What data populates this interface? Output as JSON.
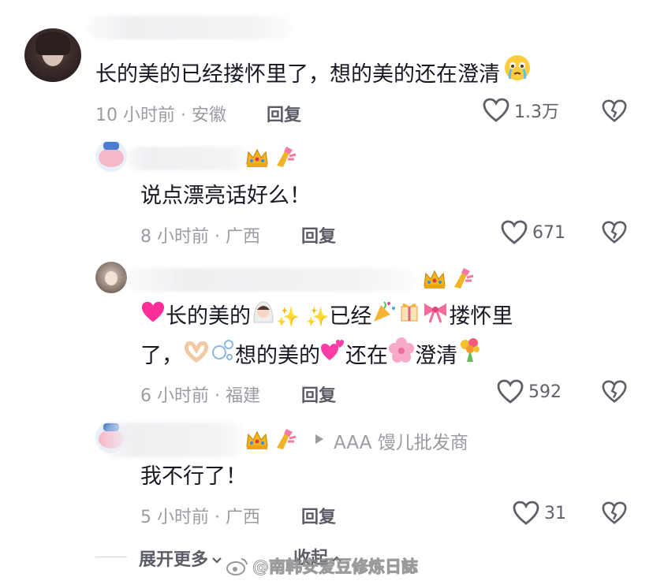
{
  "comments": [
    {
      "text": "长的美的已经搂怀里了，想的美的还在澄清",
      "meta": "10 小时前 · 安徽",
      "reply_label": "回复",
      "likes": "1.3万"
    },
    {
      "text": "说点漂亮话好么！",
      "meta": "8 小时前 · 广西",
      "reply_label": "回复",
      "likes": "671"
    },
    {
      "line1": [
        "长的美的",
        "已经",
        "搂怀里"
      ],
      "line2": [
        "了，",
        "想的美的",
        "还在",
        "澄清"
      ],
      "meta": "6 小时前 · 福建",
      "reply_label": "回复",
      "likes": "592"
    },
    {
      "reply_to": "AAA 馒儿批发商",
      "text": "我不行了！",
      "meta": "5 小时前 · 广西",
      "reply_label": "回复",
      "likes": "31"
    }
  ],
  "footer": {
    "expand_label": "展开更多",
    "collapse_label": "收起",
    "watermark": "@南韩安爱豆修炼日誌"
  },
  "colors": {
    "heart_outline": "#5d5e66",
    "meta_text": "#9a9ba3",
    "crown": "#f3b51b",
    "nail": "#f0b428",
    "pink_heart": "#ff2d9a"
  }
}
